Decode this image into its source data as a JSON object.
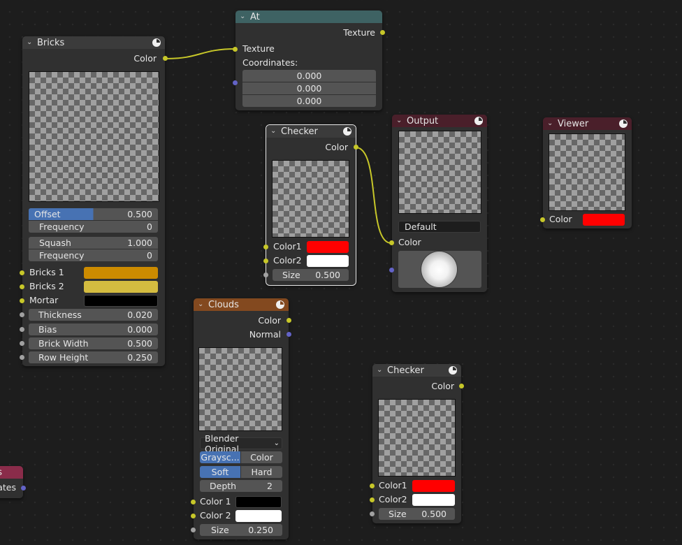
{
  "app": "Blender Texture Node Editor",
  "colors": {
    "socket_color": "#c7c729",
    "socket_vector": "#6363c7",
    "socket_value": "#a1a1a1",
    "header_texture": "#3b3b3b",
    "header_converter": "#3e6263",
    "header_output": "#4a1f2a",
    "header_clouds": "#83491f",
    "accent_blue": "#4772b3",
    "link": "#c7c729"
  },
  "nodes": {
    "bricks": {
      "title": "Bricks",
      "output": "Color",
      "offset": {
        "label": "Offset",
        "value": "0.500",
        "fill": 0.5
      },
      "offset_frequency": {
        "label": "Frequency",
        "value": "0"
      },
      "squash": {
        "label": "Squash",
        "value": "1.000"
      },
      "squash_frequency": {
        "label": "Frequency",
        "value": "0"
      },
      "bricks1": {
        "label": "Bricks 1",
        "color": "#cc8b00"
      },
      "bricks2": {
        "label": "Bricks 2",
        "color": "#d4bc40"
      },
      "mortar": {
        "label": "Mortar",
        "color": "#000000"
      },
      "thickness": {
        "label": "Thickness",
        "value": "0.020"
      },
      "bias": {
        "label": "Bias",
        "value": "0.000"
      },
      "brick_width": {
        "label": "Brick Width",
        "value": "0.500"
      },
      "row_height": {
        "label": "Row Height",
        "value": "0.250"
      }
    },
    "at": {
      "title": "At",
      "output": "Texture",
      "input_texture": "Texture",
      "coordinates_label": "Coordinates:",
      "coords": [
        "0.000",
        "0.000",
        "0.000"
      ]
    },
    "checker1": {
      "title": "Checker",
      "output": "Color",
      "color1": {
        "label": "Color1",
        "color": "#ff0000"
      },
      "color2": {
        "label": "Color2",
        "color": "#ffffff"
      },
      "size": {
        "label": "Size",
        "value": "0.500"
      }
    },
    "output": {
      "title": "Output",
      "name_field": "Default",
      "input_color": "Color"
    },
    "viewer": {
      "title": "Viewer",
      "input_color": {
        "label": "Color",
        "color": "#ff0000"
      }
    },
    "clouds": {
      "title": "Clouds",
      "output_color": "Color",
      "output_normal": "Normal",
      "noise_basis": "Blender Original",
      "dropdown_arrow": "⌄",
      "type_options": [
        "Graysc...",
        "Color"
      ],
      "type_selected": 0,
      "hardness_options": [
        "Soft",
        "Hard"
      ],
      "hardness_selected": 0,
      "depth": {
        "label": "Depth",
        "value": "2"
      },
      "color1": {
        "label": "Color 1",
        "color": "#000000"
      },
      "color2": {
        "label": "Color 2",
        "color": "#ffffff"
      },
      "size": {
        "label": "Size",
        "value": "0.250"
      }
    },
    "checker2": {
      "title": "Checker",
      "output": "Color",
      "color1": {
        "label": "Color1",
        "color": "#ff0000"
      },
      "color2": {
        "label": "Color2",
        "color": "#ffffff"
      },
      "size": {
        "label": "Size",
        "value": "0.500"
      }
    },
    "partial": {
      "title_fragment": "s",
      "output_fragment": "ates"
    }
  },
  "icons": {
    "collapse": "chevron-down-icon",
    "node_preview": "world-sphere-icon"
  }
}
